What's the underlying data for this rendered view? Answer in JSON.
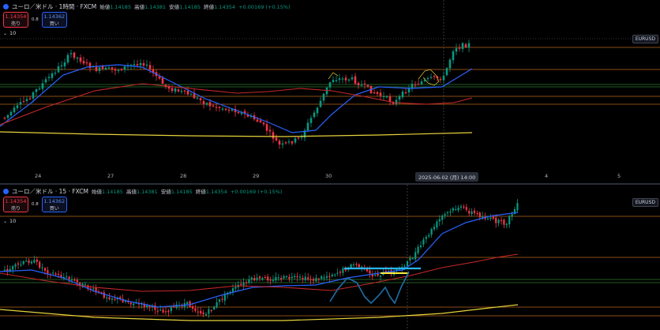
{
  "pane1": {
    "title": "ユーロ／米ドル · 1時間 · FXCM",
    "ohlc": [
      {
        "label": "始値",
        "value": "1.14185"
      },
      {
        "label": "高値",
        "value": "1.14381"
      },
      {
        "label": "安値",
        "value": "1.14185"
      },
      {
        "label": "終値",
        "value": "1.14354"
      }
    ],
    "change": "+0.00169 (+0.15%)",
    "sell_price": "1.14354",
    "sell_label": "売り",
    "spread": "0.8",
    "buy_price": "1.14362",
    "buy_label": "買い",
    "volume_label": "10",
    "symbol_tag": "EURUSD",
    "x_labels": [
      "24",
      "27",
      "28",
      "29",
      "30",
      "4",
      "5"
    ],
    "crosshair_label": "2025-06-02 (月)   14:00"
  },
  "pane2": {
    "title": "ユーロ／米ドル · 15 · FXCM",
    "ohlc": [
      {
        "label": "始値",
        "value": "1.14185"
      },
      {
        "label": "高値",
        "value": "1.14381"
      },
      {
        "label": "安値",
        "value": "1.14185"
      },
      {
        "label": "終値",
        "value": "1.14354"
      }
    ],
    "change": "+0.00169 (+0.15%)",
    "sell_price": "1.14354",
    "sell_label": "売り",
    "spread": "0.8",
    "buy_price": "1.14362",
    "buy_label": "買い",
    "volume_label": "10",
    "symbol_tag": "EURUSD"
  },
  "colors": {
    "up": "#089981",
    "down": "#f23645",
    "ma_fast": "#2962ff",
    "ma_mid": "#c62828",
    "ma_slow": "#e6d23a",
    "hline_orange": "#b8651a",
    "hline_green": "#2e7d32"
  }
}
